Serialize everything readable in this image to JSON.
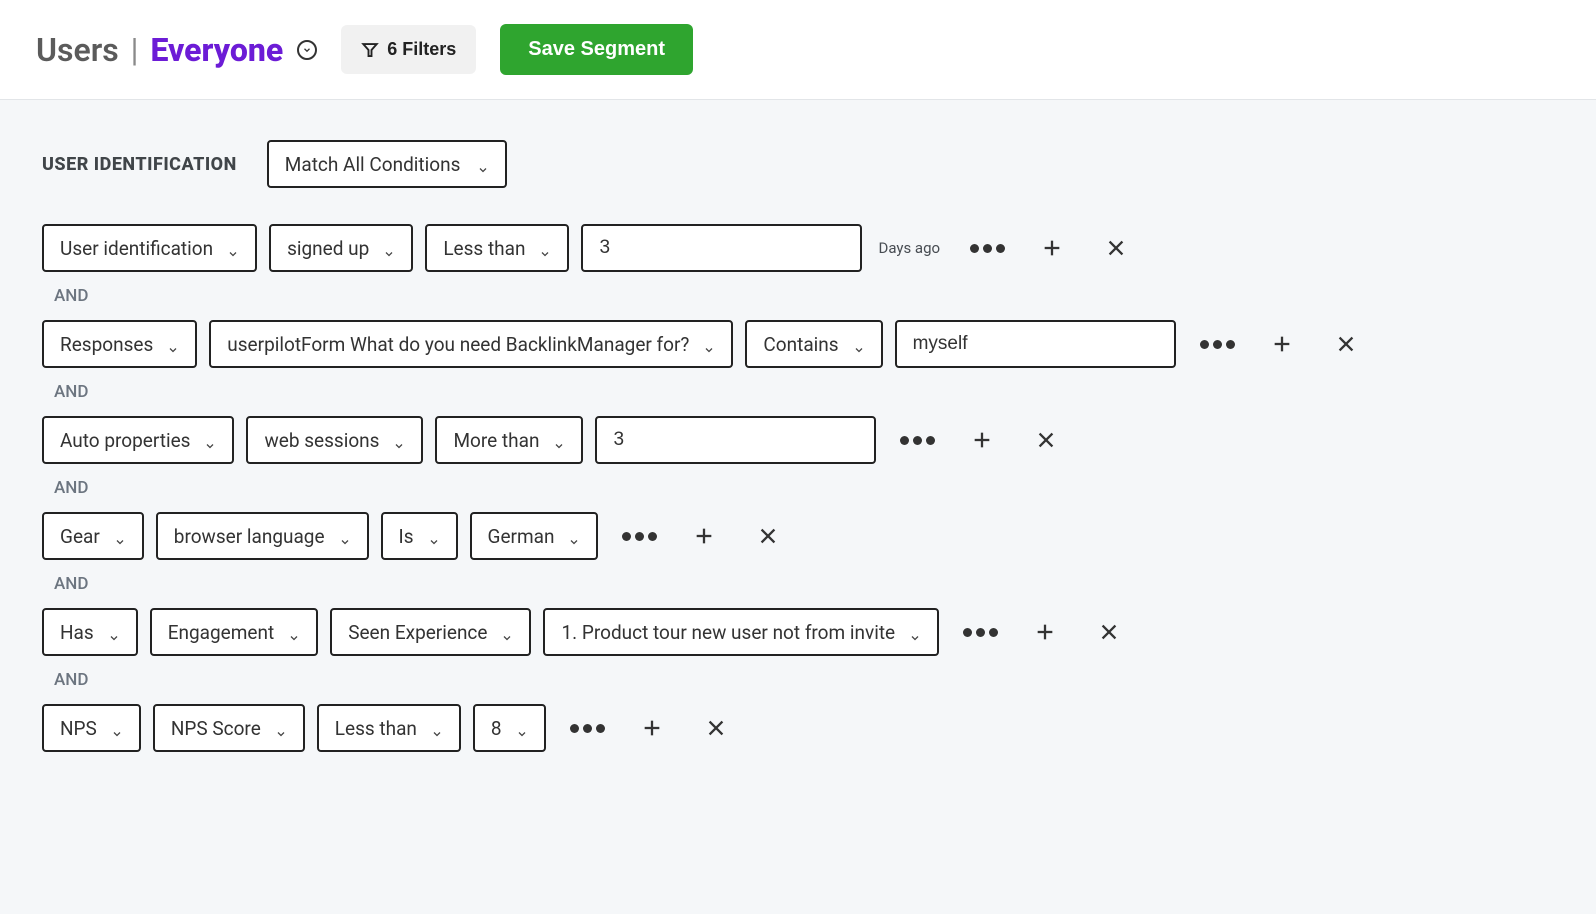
{
  "header": {
    "title_prefix": "Users",
    "segment_name": "Everyone",
    "filter_count_label": "6 Filters",
    "save_label": "Save Segment"
  },
  "section": {
    "label": "USER IDENTIFICATION",
    "match_mode": "Match All Conditions"
  },
  "conjunction": "AND",
  "conditions": [
    {
      "parts": [
        {
          "type": "select",
          "value": "User identification"
        },
        {
          "type": "select",
          "value": "signed up"
        },
        {
          "type": "select",
          "value": "Less than"
        },
        {
          "type": "input",
          "value": "3"
        },
        {
          "type": "suffix",
          "value": "Days ago"
        }
      ]
    },
    {
      "parts": [
        {
          "type": "select",
          "value": "Responses"
        },
        {
          "type": "select",
          "value": "userpilotForm What do you need BacklinkManager for?",
          "wide": true
        },
        {
          "type": "select",
          "value": "Contains"
        },
        {
          "type": "input",
          "value": "myself"
        }
      ]
    },
    {
      "parts": [
        {
          "type": "select",
          "value": "Auto properties"
        },
        {
          "type": "select",
          "value": "web sessions"
        },
        {
          "type": "select",
          "value": "More than"
        },
        {
          "type": "input",
          "value": "3"
        }
      ]
    },
    {
      "parts": [
        {
          "type": "select",
          "value": "Gear"
        },
        {
          "type": "select",
          "value": "browser language"
        },
        {
          "type": "select",
          "value": "Is"
        },
        {
          "type": "select",
          "value": "German"
        }
      ]
    },
    {
      "parts": [
        {
          "type": "select",
          "value": "Has"
        },
        {
          "type": "select",
          "value": "Engagement"
        },
        {
          "type": "select",
          "value": "Seen Experience"
        },
        {
          "type": "select",
          "value": "1. Product tour new user not from invite",
          "wide": true
        }
      ]
    },
    {
      "parts": [
        {
          "type": "select",
          "value": "NPS"
        },
        {
          "type": "select",
          "value": "NPS Score"
        },
        {
          "type": "select",
          "value": "Less than"
        },
        {
          "type": "select",
          "value": "8"
        }
      ]
    }
  ]
}
